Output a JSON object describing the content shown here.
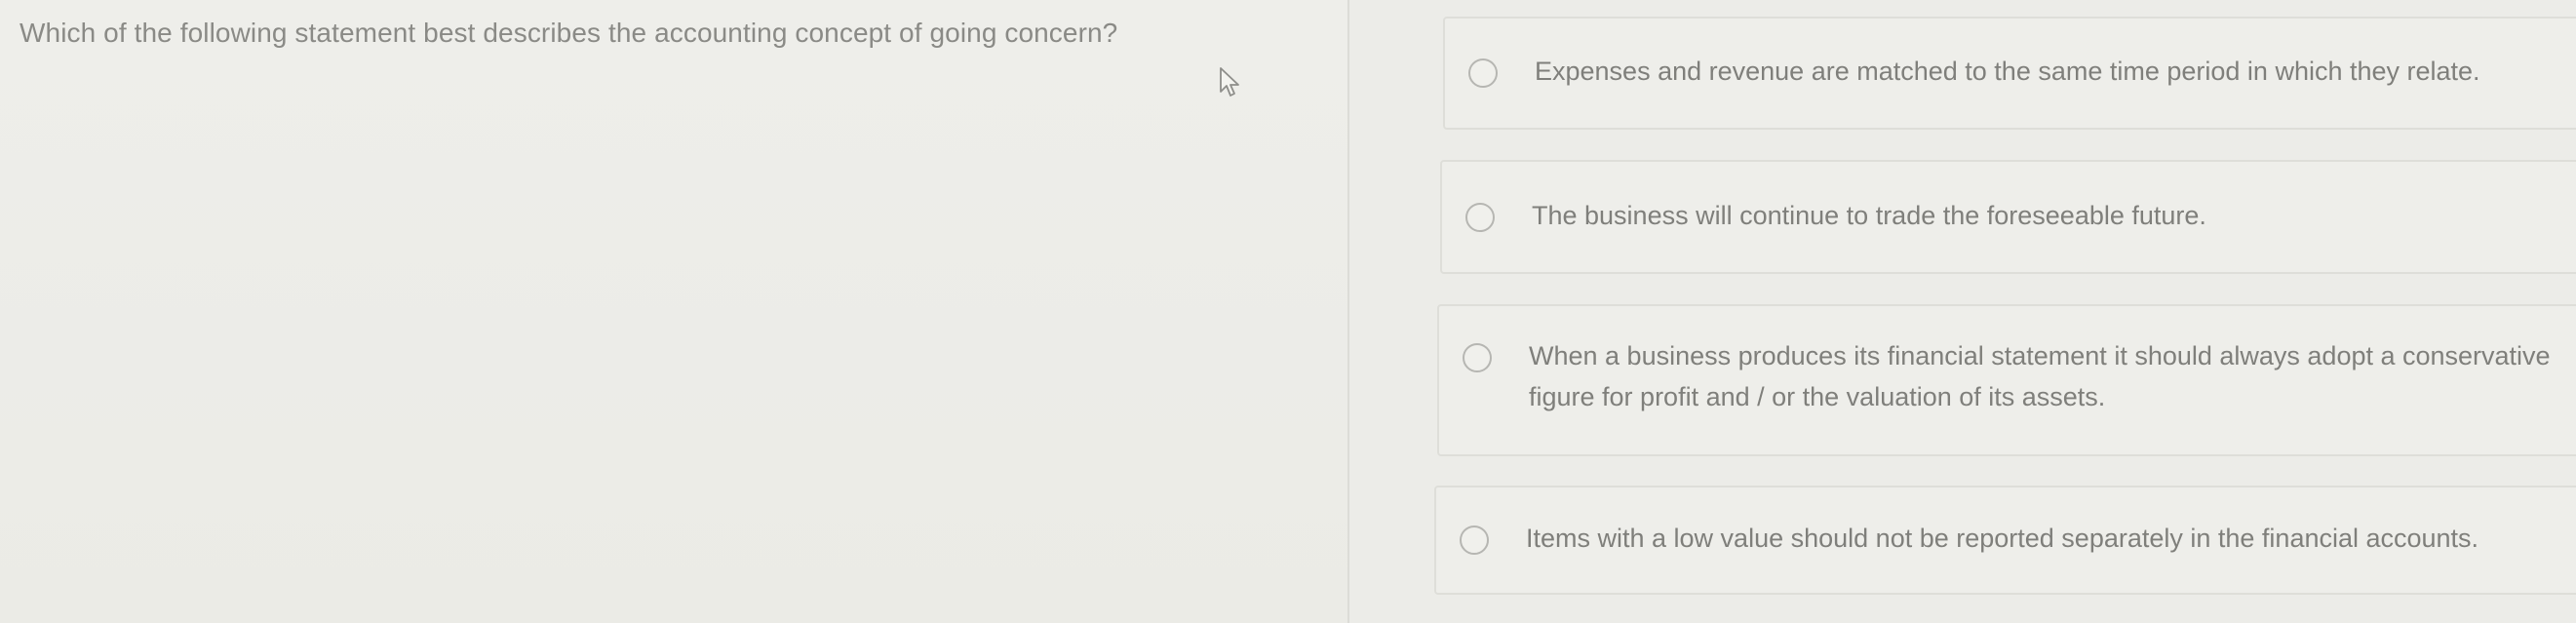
{
  "question": {
    "text": "Which of the following statement best describes the accounting concept of going concern?"
  },
  "options": [
    {
      "label": "Expenses and revenue are matched to the same time period in which they relate.",
      "selected": false
    },
    {
      "label": "The business will continue to trade the foreseeable future.",
      "selected": false
    },
    {
      "label": "When a business produces its financial statement it should always adopt a conservative figure for profit and / or the valuation of its assets.",
      "selected": false
    },
    {
      "label": "Items with a low value should not be reported separately in the financial accounts.",
      "selected": false
    }
  ],
  "icons": {
    "cursor": "mouse-pointer-icon",
    "radio": "radio-button-icon"
  },
  "colors": {
    "background": "#ecece8",
    "text": "#7f7f7b",
    "border": "#dedeD9"
  }
}
